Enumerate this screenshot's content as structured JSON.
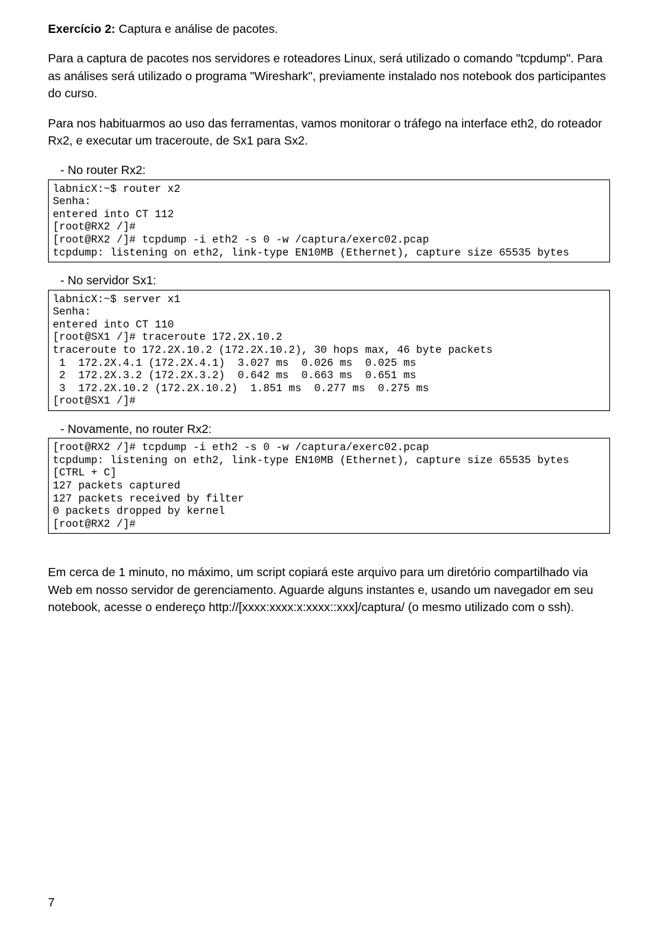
{
  "title_bold": "Exercício 2:",
  "title_rest": " Captura e análise de pacotes.",
  "para1": "Para a captura de pacotes nos servidores e roteadores Linux, será utilizado o comando \"tcpdump\". Para as análises será utilizado o programa \"Wireshark\", previamente instalado nos notebook dos participantes do curso.",
  "para2": "Para nos habituarmos ao uso das ferramentas, vamos monitorar o tráfego na interface eth2, do roteador Rx2, e executar um traceroute, de Sx1 para Sx2.",
  "label1": "- No router Rx2:",
  "code1": "labnicX:~$ router x2\nSenha:\nentered into CT 112\n[root@RX2 /]#\n[root@RX2 /]# tcpdump -i eth2 -s 0 -w /captura/exerc02.pcap\ntcpdump: listening on eth2, link-type EN10MB (Ethernet), capture size 65535 bytes",
  "label2": "- No servidor Sx1:",
  "code2": "labnicX:~$ server x1\nSenha:\nentered into CT 110\n[root@SX1 /]# traceroute 172.2X.10.2\ntraceroute to 172.2X.10.2 (172.2X.10.2), 30 hops max, 46 byte packets\n 1  172.2X.4.1 (172.2X.4.1)  3.027 ms  0.026 ms  0.025 ms\n 2  172.2X.3.2 (172.2X.3.2)  0.642 ms  0.663 ms  0.651 ms\n 3  172.2X.10.2 (172.2X.10.2)  1.851 ms  0.277 ms  0.275 ms\n[root@SX1 /]#",
  "label3": "- Novamente, no router Rx2:",
  "code3": "[root@RX2 /]# tcpdump -i eth2 -s 0 -w /captura/exerc02.pcap\ntcpdump: listening on eth2, link-type EN10MB (Ethernet), capture size 65535 bytes\n[CTRL + C]\n127 packets captured\n127 packets received by filter\n0 packets dropped by kernel\n[root@RX2 /]#",
  "para3": "Em cerca de 1 minuto, no máximo, um script copiará este arquivo para um diretório compartilhado via Web em nosso servidor de gerenciamento. Aguarde alguns instantes e, usando um navegador em seu notebook, acesse o endereço http://[xxxx:xxxx:x:xxxx::xxx]/captura/ (o mesmo utilizado com o ssh).",
  "page_number": "7"
}
